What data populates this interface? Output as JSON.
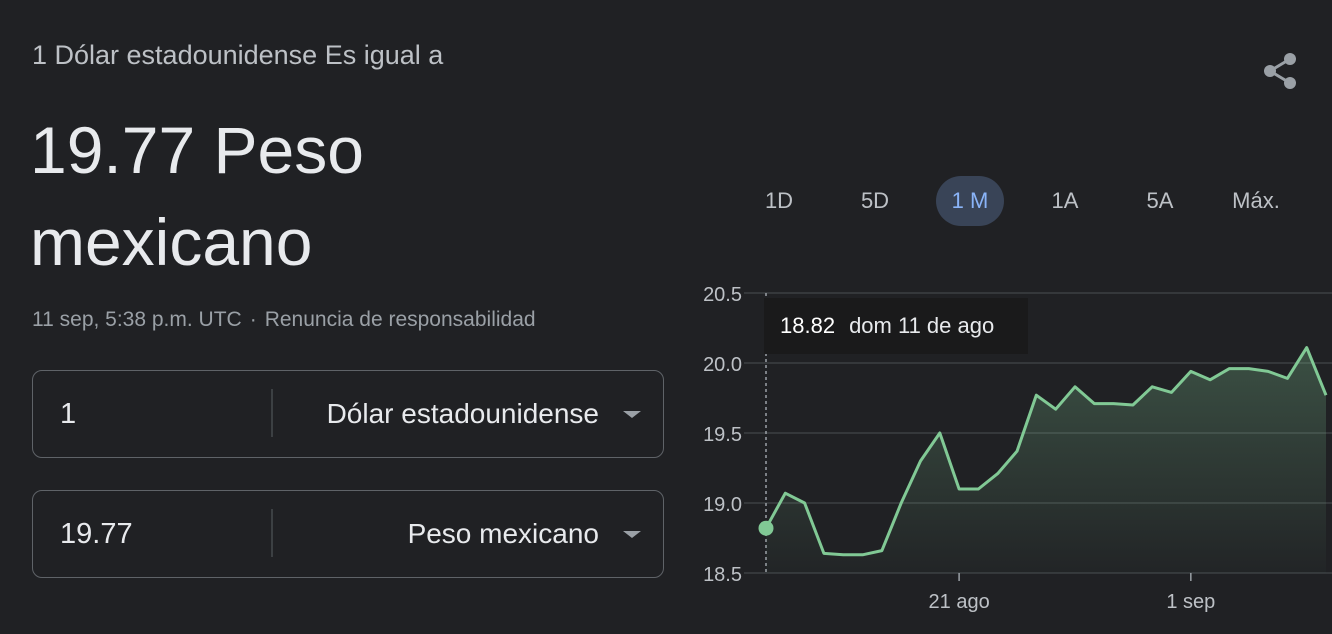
{
  "converter": {
    "equals_label": "1 Dólar estadounidense Es igual a",
    "result": "19.77 Peso mexicano",
    "timestamp": "11 sep, 5:38 p.m. UTC",
    "separator": "·",
    "disclaimer": "Renuncia de responsabilidad",
    "from": {
      "amount": "1",
      "currency": "Dólar estadounidense"
    },
    "to": {
      "amount": "19.77",
      "currency": "Peso mexicano"
    }
  },
  "share_icon": "share-icon",
  "range_tabs": [
    {
      "label": "1D",
      "active": false
    },
    {
      "label": "5D",
      "active": false
    },
    {
      "label": "1 M",
      "active": true
    },
    {
      "label": "1A",
      "active": false
    },
    {
      "label": "5A",
      "active": false
    },
    {
      "label": "Máx.",
      "active": false
    }
  ],
  "tooltip": {
    "value": "18.82",
    "date": "dom 11 de ago"
  },
  "colors": {
    "background": "#202124",
    "line": "#81c995",
    "active_tab_bg": "#394457",
    "active_tab_text": "#8ab4f8",
    "grid": "#3c4043"
  },
  "chart_data": {
    "type": "area",
    "title": "",
    "xlabel": "",
    "ylabel": "",
    "ylim": [
      18.5,
      20.5
    ],
    "y_ticks": [
      "20.5",
      "20.0",
      "19.5",
      "19.0",
      "18.5"
    ],
    "x_tick_labels": [
      {
        "label": "21 ago",
        "index": 10
      },
      {
        "label": "1 sep",
        "index": 22
      }
    ],
    "grid": true,
    "series": [
      {
        "values": [
          18.82,
          19.07,
          19.0,
          18.64,
          18.63,
          18.63,
          18.66,
          19.0,
          19.3,
          19.5,
          19.1,
          19.1,
          19.21,
          19.37,
          19.77,
          19.67,
          19.83,
          19.71,
          19.71,
          19.7,
          19.83,
          19.79,
          19.94,
          19.88,
          19.96,
          19.96,
          19.94,
          19.89,
          20.11,
          19.77
        ]
      }
    ],
    "highlight_index": 0
  }
}
